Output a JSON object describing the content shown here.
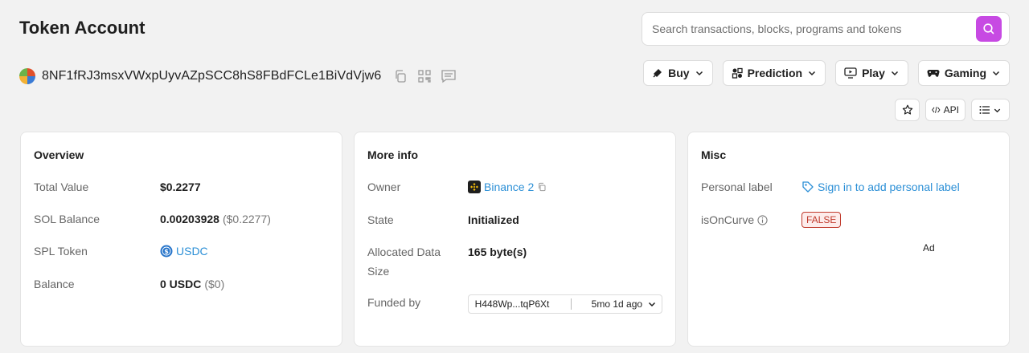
{
  "header": {
    "title": "Token Account",
    "search_placeholder": "Search transactions, blocks, programs and tokens"
  },
  "account": {
    "address": "8NF1fRJ3msxVWxpUyvAZpSCC8hS8FBdFCLe1BiVdVjw6"
  },
  "nav": [
    {
      "label": "Buy",
      "icon": "buy-icon"
    },
    {
      "label": "Prediction",
      "icon": "prediction-icon"
    },
    {
      "label": "Play",
      "icon": "play-icon"
    },
    {
      "label": "Gaming",
      "icon": "gamepad-icon"
    }
  ],
  "toolbar": {
    "api_label": "API"
  },
  "overview": {
    "title": "Overview",
    "total_value_label": "Total Value",
    "total_value": "$0.2277",
    "sol_balance_label": "SOL Balance",
    "sol_balance": "0.00203928",
    "sol_balance_usd": "($0.2277)",
    "spl_token_label": "SPL Token",
    "spl_token": "USDC",
    "balance_label": "Balance",
    "balance": "0 USDC",
    "balance_usd": "($0)"
  },
  "more_info": {
    "title": "More info",
    "owner_label": "Owner",
    "owner": "Binance 2",
    "state_label": "State",
    "state": "Initialized",
    "allocated_label": "Allocated Data Size",
    "allocated": "165 byte(s)",
    "funded_label": "Funded by",
    "funded_tx": "H448Wp...tqP6Xt",
    "funded_ago": "5mo 1d ago"
  },
  "misc": {
    "title": "Misc",
    "personal_label_label": "Personal label",
    "personal_label_link": "Sign in to add personal label",
    "is_on_curve_label": "isOnCurve",
    "is_on_curve": "FALSE",
    "ad_label": "Ad"
  },
  "colors": {
    "accent": "#c74ae3",
    "link": "#2b8fd6",
    "false_badge": "#c0392b",
    "background": "#f2f2f2"
  }
}
